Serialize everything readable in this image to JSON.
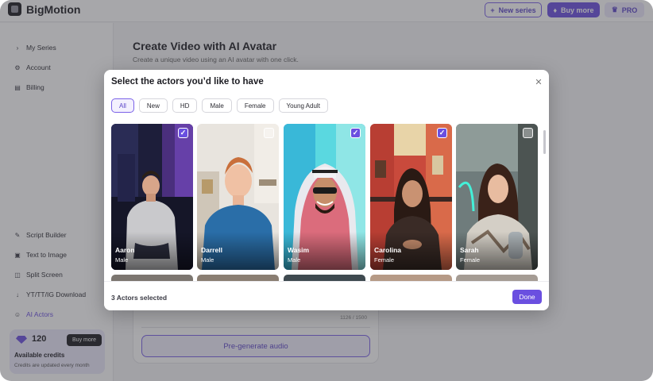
{
  "header": {
    "brand": "BigMotion",
    "new_series": "New series",
    "buy_more": "Buy more",
    "pro": "PRO"
  },
  "sidebar": {
    "items": [
      {
        "label": "My Series",
        "icon": "chevron-right-icon"
      },
      {
        "label": "Account",
        "icon": "gear-icon"
      },
      {
        "label": "Billing",
        "icon": "wallet-icon"
      },
      {
        "label": "Script Builder",
        "icon": "script-icon"
      },
      {
        "label": "Text to Image",
        "icon": "image-icon"
      },
      {
        "label": "Split Screen",
        "icon": "split-icon"
      },
      {
        "label": "YT/TT/IG Download",
        "icon": "download-icon"
      },
      {
        "label": "AI Actors",
        "icon": "actors-icon"
      }
    ],
    "credits": {
      "amount": "120",
      "buy_label": "Buy more",
      "label": "Available credits",
      "note": "Credits are updated every month"
    }
  },
  "main": {
    "title": "Create Video with AI Avatar",
    "subtitle": "Create a unique video using an AI avatar with one click.",
    "char_count": "1126 / 1500",
    "pregenerate": "Pre-generate audio"
  },
  "modal": {
    "title": "Select the actors you’d like to have",
    "filters": [
      {
        "label": "All",
        "active": true
      },
      {
        "label": "New",
        "active": false
      },
      {
        "label": "HD",
        "active": false
      },
      {
        "label": "Male",
        "active": false
      },
      {
        "label": "Female",
        "active": false
      },
      {
        "label": "Young Adult",
        "active": false
      }
    ],
    "actors": [
      {
        "name": "Aaron",
        "gender": "Male",
        "selected": true
      },
      {
        "name": "Darrell",
        "gender": "Male",
        "selected": false
      },
      {
        "name": "Wasim",
        "gender": "Male",
        "selected": true
      },
      {
        "name": "Carolina",
        "gender": "Female",
        "selected": true
      },
      {
        "name": "Sarah",
        "gender": "Female",
        "selected": false
      }
    ],
    "selected_count": "3 Actors selected",
    "done": "Done"
  },
  "colors": {
    "accent": "#6a4fe0",
    "overlay": "#3c3c42"
  }
}
